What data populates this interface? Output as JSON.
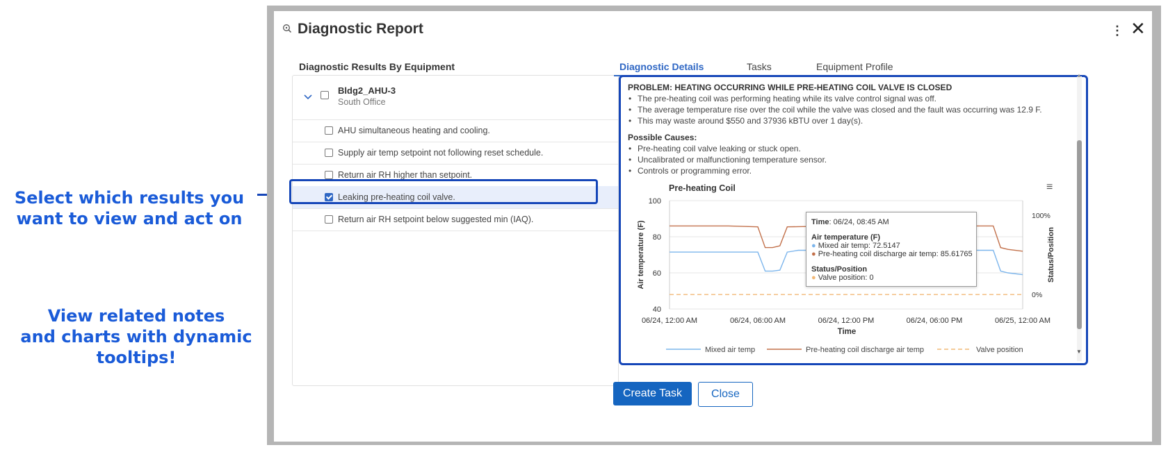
{
  "annotations": {
    "select": [
      "Select which results you",
      "want to view and act on"
    ],
    "view": [
      "View related notes",
      "and charts with dynamic",
      "tooltips!"
    ]
  },
  "modal": {
    "title": "Diagnostic Report",
    "close_label": "Close",
    "create_task_label": "Create Task"
  },
  "left": {
    "title": "Diagnostic Results By Equipment",
    "equipment": {
      "name": "Bldg2_AHU-3",
      "location": "South Office"
    },
    "diagnostics": [
      {
        "label": "AHU simultaneous heating and cooling.",
        "checked": false
      },
      {
        "label": "Supply air temp setpoint not following reset schedule.",
        "checked": false
      },
      {
        "label": "Return air RH higher than setpoint.",
        "checked": false
      },
      {
        "label": "Leaking pre-heating coil valve.",
        "checked": true
      },
      {
        "label": "Return air RH setpoint below suggested min (IAQ).",
        "checked": false
      }
    ]
  },
  "tabs": [
    "Diagnostic Details",
    "Tasks",
    "Equipment Profile"
  ],
  "details": {
    "problem_heading": "PROBLEM: HEATING OCCURRING WHILE PRE-HEATING COIL VALVE IS CLOSED",
    "problem_bullets": [
      "The pre-heating coil was performing heating while its valve control signal was off.",
      "The average temperature rise over the coil while the valve was closed and the fault was occurring was 12.9 F.",
      "This may waste around $550 and 37936 kBTU over 1 day(s)."
    ],
    "causes_heading": "Possible Causes:",
    "causes_bullets": [
      "Pre-heating coil valve leaking or stuck open.",
      "Uncalibrated or malfunctioning temperature sensor.",
      "Controls or programming error."
    ]
  },
  "tooltip": {
    "time_label": "Time",
    "time_value": ": 06/24, 08:45 AM",
    "group1": "Air temperature (F)",
    "line1": "Mixed air temp: 72.5147",
    "line2": "Pre-heating coil discharge air temp: 85.61765",
    "group2": "Status/Position",
    "line3": "Valve position: 0"
  },
  "chart_data": {
    "type": "line",
    "title": "Pre-heating Coil",
    "xlabel": "Time",
    "ylabel": "Air temperature (F)",
    "ylabel_right": "Status/Position",
    "ylim": [
      40,
      100
    ],
    "yticks": [
      "100",
      "80",
      "60",
      "40"
    ],
    "yticks_right": [
      "100%",
      "0%"
    ],
    "xticks": [
      "06/24, 12:00 AM",
      "06/24, 06:00 AM",
      "06/24, 12:00 PM",
      "06/24, 06:00 PM",
      "06/25, 12:00 AM"
    ],
    "x_hours": [
      0,
      2,
      4,
      6,
      6.5,
      7,
      7.5,
      8,
      8.75,
      10,
      12,
      14,
      16,
      18,
      20,
      22,
      22.5,
      23,
      24
    ],
    "series": [
      {
        "name": "Mixed air temp",
        "color": "#7cb5ec",
        "dash": false,
        "values": [
          71.5,
          71.5,
          71.5,
          71.5,
          61,
          61,
          61.5,
          71.5,
          72.5,
          72.5,
          72.5,
          72.5,
          72.5,
          72.5,
          72.5,
          72.5,
          61,
          60,
          59
        ]
      },
      {
        "name": "Pre-heating coil discharge air temp",
        "color": "#c2704a",
        "dash": false,
        "values": [
          86,
          86,
          86,
          85.5,
          74,
          74,
          75,
          85.5,
          85.6,
          85.8,
          86,
          86,
          86,
          86,
          86,
          86,
          74,
          73,
          72
        ]
      },
      {
        "name": "Valve position",
        "color": "#f2b876",
        "dash": true,
        "values": [
          48,
          48,
          48,
          48,
          48,
          48,
          48,
          48,
          48,
          48,
          48,
          48,
          48,
          48,
          48,
          48,
          48,
          48,
          48
        ]
      }
    ]
  }
}
